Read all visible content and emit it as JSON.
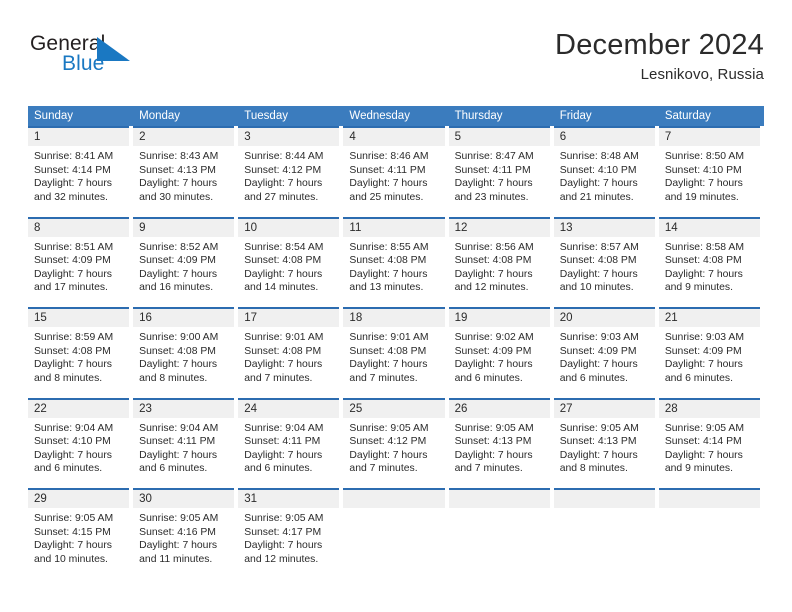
{
  "brand": {
    "name_dark": "General",
    "name_blue": "Blue",
    "triangle_color": "#1a78c2"
  },
  "header": {
    "title": "December 2024",
    "subtitle": "Lesnikovo, Russia"
  },
  "colors": {
    "header_blue": "#3b7cbe",
    "cell_top_border": "#2c6cb0",
    "day_number_band": "#f0f0f0",
    "text": "#2b2b2b",
    "brand_blue": "#1a78c2"
  },
  "weekdays": [
    "Sunday",
    "Monday",
    "Tuesday",
    "Wednesday",
    "Thursday",
    "Friday",
    "Saturday"
  ],
  "weeks": [
    [
      {
        "day": "1",
        "sunrise": "Sunrise: 8:41 AM",
        "sunset": "Sunset: 4:14 PM",
        "daylight1": "Daylight: 7 hours",
        "daylight2": "and 32 minutes."
      },
      {
        "day": "2",
        "sunrise": "Sunrise: 8:43 AM",
        "sunset": "Sunset: 4:13 PM",
        "daylight1": "Daylight: 7 hours",
        "daylight2": "and 30 minutes."
      },
      {
        "day": "3",
        "sunrise": "Sunrise: 8:44 AM",
        "sunset": "Sunset: 4:12 PM",
        "daylight1": "Daylight: 7 hours",
        "daylight2": "and 27 minutes."
      },
      {
        "day": "4",
        "sunrise": "Sunrise: 8:46 AM",
        "sunset": "Sunset: 4:11 PM",
        "daylight1": "Daylight: 7 hours",
        "daylight2": "and 25 minutes."
      },
      {
        "day": "5",
        "sunrise": "Sunrise: 8:47 AM",
        "sunset": "Sunset: 4:11 PM",
        "daylight1": "Daylight: 7 hours",
        "daylight2": "and 23 minutes."
      },
      {
        "day": "6",
        "sunrise": "Sunrise: 8:48 AM",
        "sunset": "Sunset: 4:10 PM",
        "daylight1": "Daylight: 7 hours",
        "daylight2": "and 21 minutes."
      },
      {
        "day": "7",
        "sunrise": "Sunrise: 8:50 AM",
        "sunset": "Sunset: 4:10 PM",
        "daylight1": "Daylight: 7 hours",
        "daylight2": "and 19 minutes."
      }
    ],
    [
      {
        "day": "8",
        "sunrise": "Sunrise: 8:51 AM",
        "sunset": "Sunset: 4:09 PM",
        "daylight1": "Daylight: 7 hours",
        "daylight2": "and 17 minutes."
      },
      {
        "day": "9",
        "sunrise": "Sunrise: 8:52 AM",
        "sunset": "Sunset: 4:09 PM",
        "daylight1": "Daylight: 7 hours",
        "daylight2": "and 16 minutes."
      },
      {
        "day": "10",
        "sunrise": "Sunrise: 8:54 AM",
        "sunset": "Sunset: 4:08 PM",
        "daylight1": "Daylight: 7 hours",
        "daylight2": "and 14 minutes."
      },
      {
        "day": "11",
        "sunrise": "Sunrise: 8:55 AM",
        "sunset": "Sunset: 4:08 PM",
        "daylight1": "Daylight: 7 hours",
        "daylight2": "and 13 minutes."
      },
      {
        "day": "12",
        "sunrise": "Sunrise: 8:56 AM",
        "sunset": "Sunset: 4:08 PM",
        "daylight1": "Daylight: 7 hours",
        "daylight2": "and 12 minutes."
      },
      {
        "day": "13",
        "sunrise": "Sunrise: 8:57 AM",
        "sunset": "Sunset: 4:08 PM",
        "daylight1": "Daylight: 7 hours",
        "daylight2": "and 10 minutes."
      },
      {
        "day": "14",
        "sunrise": "Sunrise: 8:58 AM",
        "sunset": "Sunset: 4:08 PM",
        "daylight1": "Daylight: 7 hours",
        "daylight2": "and 9 minutes."
      }
    ],
    [
      {
        "day": "15",
        "sunrise": "Sunrise: 8:59 AM",
        "sunset": "Sunset: 4:08 PM",
        "daylight1": "Daylight: 7 hours",
        "daylight2": "and 8 minutes."
      },
      {
        "day": "16",
        "sunrise": "Sunrise: 9:00 AM",
        "sunset": "Sunset: 4:08 PM",
        "daylight1": "Daylight: 7 hours",
        "daylight2": "and 8 minutes."
      },
      {
        "day": "17",
        "sunrise": "Sunrise: 9:01 AM",
        "sunset": "Sunset: 4:08 PM",
        "daylight1": "Daylight: 7 hours",
        "daylight2": "and 7 minutes."
      },
      {
        "day": "18",
        "sunrise": "Sunrise: 9:01 AM",
        "sunset": "Sunset: 4:08 PM",
        "daylight1": "Daylight: 7 hours",
        "daylight2": "and 7 minutes."
      },
      {
        "day": "19",
        "sunrise": "Sunrise: 9:02 AM",
        "sunset": "Sunset: 4:09 PM",
        "daylight1": "Daylight: 7 hours",
        "daylight2": "and 6 minutes."
      },
      {
        "day": "20",
        "sunrise": "Sunrise: 9:03 AM",
        "sunset": "Sunset: 4:09 PM",
        "daylight1": "Daylight: 7 hours",
        "daylight2": "and 6 minutes."
      },
      {
        "day": "21",
        "sunrise": "Sunrise: 9:03 AM",
        "sunset": "Sunset: 4:09 PM",
        "daylight1": "Daylight: 7 hours",
        "daylight2": "and 6 minutes."
      }
    ],
    [
      {
        "day": "22",
        "sunrise": "Sunrise: 9:04 AM",
        "sunset": "Sunset: 4:10 PM",
        "daylight1": "Daylight: 7 hours",
        "daylight2": "and 6 minutes."
      },
      {
        "day": "23",
        "sunrise": "Sunrise: 9:04 AM",
        "sunset": "Sunset: 4:11 PM",
        "daylight1": "Daylight: 7 hours",
        "daylight2": "and 6 minutes."
      },
      {
        "day": "24",
        "sunrise": "Sunrise: 9:04 AM",
        "sunset": "Sunset: 4:11 PM",
        "daylight1": "Daylight: 7 hours",
        "daylight2": "and 6 minutes."
      },
      {
        "day": "25",
        "sunrise": "Sunrise: 9:05 AM",
        "sunset": "Sunset: 4:12 PM",
        "daylight1": "Daylight: 7 hours",
        "daylight2": "and 7 minutes."
      },
      {
        "day": "26",
        "sunrise": "Sunrise: 9:05 AM",
        "sunset": "Sunset: 4:13 PM",
        "daylight1": "Daylight: 7 hours",
        "daylight2": "and 7 minutes."
      },
      {
        "day": "27",
        "sunrise": "Sunrise: 9:05 AM",
        "sunset": "Sunset: 4:13 PM",
        "daylight1": "Daylight: 7 hours",
        "daylight2": "and 8 minutes."
      },
      {
        "day": "28",
        "sunrise": "Sunrise: 9:05 AM",
        "sunset": "Sunset: 4:14 PM",
        "daylight1": "Daylight: 7 hours",
        "daylight2": "and 9 minutes."
      }
    ],
    [
      {
        "day": "29",
        "sunrise": "Sunrise: 9:05 AM",
        "sunset": "Sunset: 4:15 PM",
        "daylight1": "Daylight: 7 hours",
        "daylight2": "and 10 minutes."
      },
      {
        "day": "30",
        "sunrise": "Sunrise: 9:05 AM",
        "sunset": "Sunset: 4:16 PM",
        "daylight1": "Daylight: 7 hours",
        "daylight2": "and 11 minutes."
      },
      {
        "day": "31",
        "sunrise": "Sunrise: 9:05 AM",
        "sunset": "Sunset: 4:17 PM",
        "daylight1": "Daylight: 7 hours",
        "daylight2": "and 12 minutes."
      },
      {
        "day": "",
        "sunrise": "",
        "sunset": "",
        "daylight1": "",
        "daylight2": ""
      },
      {
        "day": "",
        "sunrise": "",
        "sunset": "",
        "daylight1": "",
        "daylight2": ""
      },
      {
        "day": "",
        "sunrise": "",
        "sunset": "",
        "daylight1": "",
        "daylight2": ""
      },
      {
        "day": "",
        "sunrise": "",
        "sunset": "",
        "daylight1": "",
        "daylight2": ""
      }
    ]
  ]
}
